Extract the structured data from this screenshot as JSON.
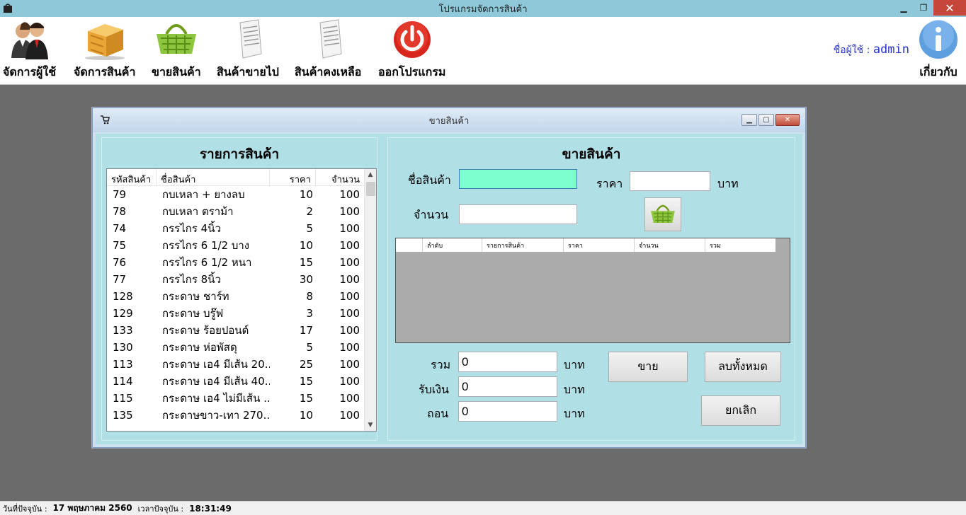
{
  "window": {
    "title": "โปรแกรมจัดการสินค้า"
  },
  "toolbar": {
    "items": [
      {
        "label": "จัดการผู้ใช้",
        "icon": "users-icon"
      },
      {
        "label": "จัดการสินค้า",
        "icon": "box-icon"
      },
      {
        "label": "ขายสินค้า",
        "icon": "basket-icon"
      },
      {
        "label": "สินค้าขายไป",
        "icon": "document-icon"
      },
      {
        "label": "สินค้าคงเหลือ",
        "icon": "document-icon"
      },
      {
        "label": "ออกโปรแกรม",
        "icon": "power-icon"
      }
    ],
    "user_prefix": "ชื่อผู้ใช้ : ",
    "user_name": "admin",
    "about_label": "เกี่ยวกับ"
  },
  "child": {
    "title": "ขายสินค้า",
    "left": {
      "title": "รายการสินค้า",
      "columns": [
        "รหัสสินค้า",
        "ชื่อสินค้า",
        "ราคา",
        "จำนวน"
      ],
      "rows": [
        [
          "79",
          "กบเหลา + ยางลบ",
          "10",
          "100"
        ],
        [
          "78",
          "กบเหลา ตราม้า",
          "2",
          "100"
        ],
        [
          "74",
          "กรรไกร 4นิ้ว",
          "5",
          "100"
        ],
        [
          "75",
          "กรรไกร 6 1/2 บาง",
          "10",
          "100"
        ],
        [
          "76",
          "กรรไกร 6 1/2 หนา",
          "15",
          "100"
        ],
        [
          "77",
          "กรรไกร 8นิ้ว",
          "30",
          "100"
        ],
        [
          "128",
          "กระดาษ ชาร์ท",
          "8",
          "100"
        ],
        [
          "129",
          "กระดาษ บรู๊ฟ",
          "3",
          "100"
        ],
        [
          "133",
          "กระดาษ ร้อยปอนด์",
          "17",
          "100"
        ],
        [
          "130",
          "กระดาษ ห่อพัสดุ",
          "5",
          "100"
        ],
        [
          "113",
          "กระดาษ เอ4 มีเส้น 20...",
          "25",
          "100"
        ],
        [
          "114",
          "กระดาษ เอ4 มีเส้น 40...",
          "15",
          "100"
        ],
        [
          "115",
          "กระดาษ เอ4 ไม่มีเส้น ...",
          "15",
          "100"
        ],
        [
          "135",
          "กระดาษขาว-เทา 270...",
          "10",
          "100"
        ]
      ]
    },
    "right": {
      "title": "ขายสินค้า",
      "product_name_label": "ชื่อสินค้า",
      "product_name_value": "",
      "price_label": "ราคา",
      "price_value": "",
      "baht": "บาท",
      "qty_label": "จำนวน",
      "qty_value": "",
      "grid_columns": [
        "ลำดับ",
        "รายการสินค้า",
        "ราคา",
        "จำนวน",
        "รวม"
      ],
      "total_label": "รวม",
      "total_value": "0",
      "received_label": "รับเงิน",
      "received_value": "0",
      "change_label": "ถอน",
      "change_value": "0",
      "sell_button": "ขาย",
      "clear_button": "ลบทั้งหมด",
      "cancel_button": "ยกเลิก"
    }
  },
  "status": {
    "date_label": "วันที่ปัจจุบัน :",
    "date_value": "17 พฤษภาคม 2560",
    "time_label": "เวลาปัจจุบัน :",
    "time_value": "18:31:49"
  }
}
